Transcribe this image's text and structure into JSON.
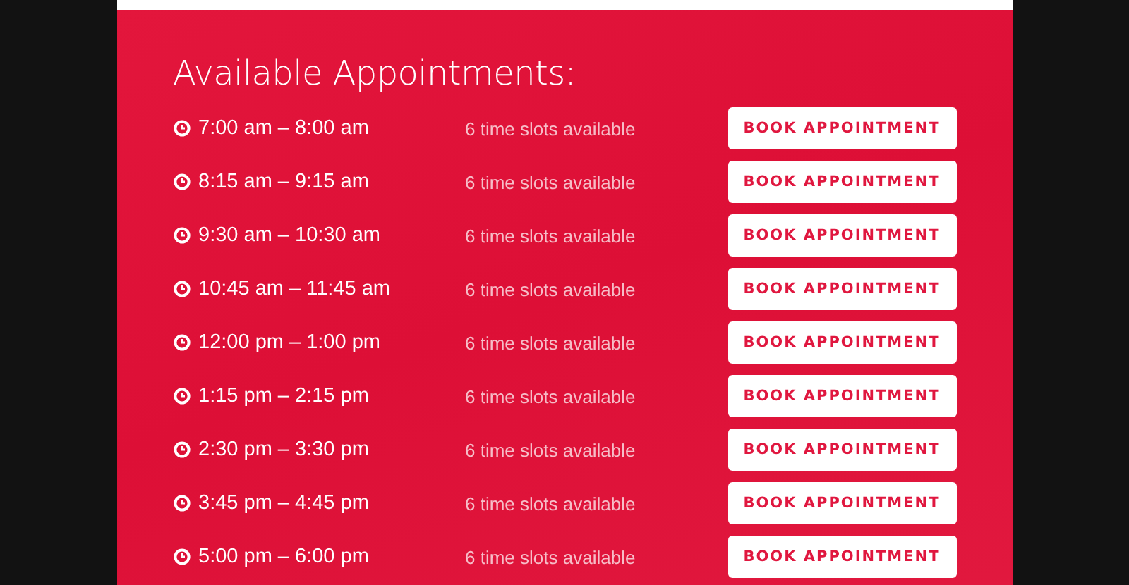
{
  "title": "Available Appointments:",
  "appointments": [
    {
      "time": "7:00 am – 8:00 am",
      "availability": "6 time slots available",
      "button": "BOOK APPOINTMENT"
    },
    {
      "time": "8:15 am – 9:15 am",
      "availability": "6 time slots available",
      "button": "BOOK APPOINTMENT"
    },
    {
      "time": "9:30 am – 10:30 am",
      "availability": "6 time slots available",
      "button": "BOOK APPOINTMENT"
    },
    {
      "time": "10:45 am – 11:45 am",
      "availability": "6 time slots available",
      "button": "BOOK APPOINTMENT"
    },
    {
      "time": "12:00 pm – 1:00 pm",
      "availability": "6 time slots available",
      "button": "BOOK APPOINTMENT"
    },
    {
      "time": "1:15 pm – 2:15 pm",
      "availability": "6 time slots available",
      "button": "BOOK APPOINTMENT"
    },
    {
      "time": "2:30 pm – 3:30 pm",
      "availability": "6 time slots available",
      "button": "BOOK APPOINTMENT"
    },
    {
      "time": "3:45 pm – 4:45 pm",
      "availability": "6 time slots available",
      "button": "BOOK APPOINTMENT"
    },
    {
      "time": "5:00 pm – 6:00 pm",
      "availability": "6 time slots available",
      "button": "BOOK APPOINTMENT"
    }
  ]
}
